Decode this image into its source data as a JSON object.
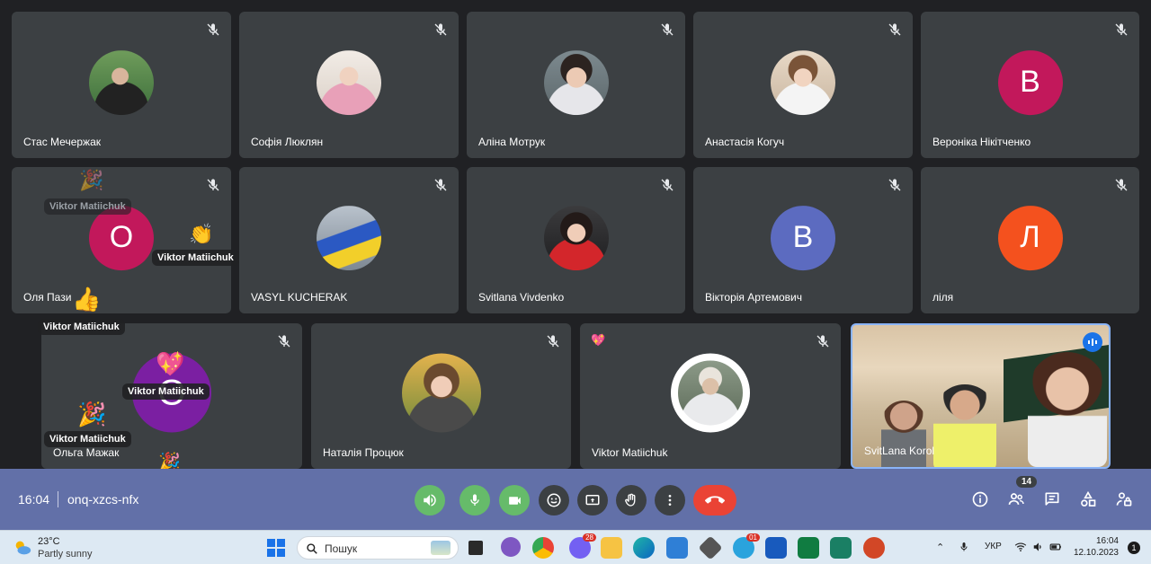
{
  "colors": {
    "tile_bg": "#3c4043",
    "stage_bg": "#202124",
    "controls_bar": "#6270a8",
    "taskbar": "#dde9f3",
    "green": "#66bb6a",
    "end_call": "#ea4335"
  },
  "participants": {
    "p01": {
      "name": "Стас Мечержак"
    },
    "p02": {
      "name": "Софія Люклян"
    },
    "p03": {
      "name": "Аліна Мотрук"
    },
    "p04": {
      "name": "Анастасія Когуч"
    },
    "p05": {
      "name": "Вероніка Нікітченко",
      "initial": "В",
      "color": "#c2185b"
    },
    "p06": {
      "name": "Оля Пази",
      "initial": "О",
      "color": "#c2185b"
    },
    "p07": {
      "name": "VASYL KUCHERAK"
    },
    "p08": {
      "name": "Svitlana Vivdenko"
    },
    "p09": {
      "name": "Вікторія Артемович",
      "initial": "В",
      "color": "#5c6bc0"
    },
    "p10": {
      "name": "ліля",
      "initial": "Л",
      "color": "#f4511e"
    },
    "p11": {
      "name": "Ольга Мажак",
      "initial": "О",
      "color": "#7b1fa2"
    },
    "p12": {
      "name": "Наталія Процюк"
    },
    "p13": {
      "name": "Viktor Matiichuk"
    },
    "p14": {
      "name": "SvitLana Korol"
    }
  },
  "reactions": {
    "reactor": "Viktor Matiichuk",
    "party": "🎉",
    "clap": "👏",
    "thumbs": "👍",
    "sparkle_heart": "💖"
  },
  "controls": {
    "time": "16:04",
    "meeting_code": "onq-xzcs-nfx",
    "people_count": "14"
  },
  "taskbar": {
    "temperature": "23°C",
    "weather": "Partly sunny",
    "search_placeholder": "Пошук",
    "viber_badge": "28",
    "telegram_badge": "01",
    "language": "УКР",
    "clock_time": "16:04",
    "clock_date": "12.10.2023",
    "notification_count": "1"
  }
}
